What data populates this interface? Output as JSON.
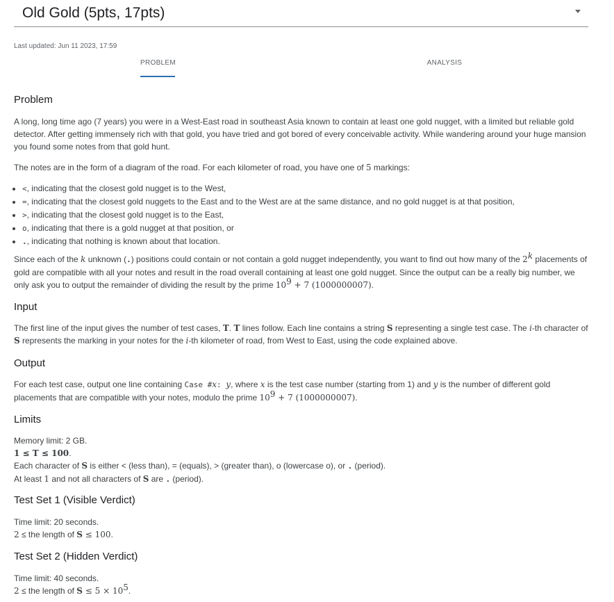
{
  "header": {
    "problem_title": "Old Gold (5pts, 17pts)",
    "last_updated": "Last updated: Jun 11 2023, 17:59"
  },
  "tabs": [
    {
      "label": "PROBLEM",
      "active": true
    },
    {
      "label": "ANALYSIS",
      "active": false
    }
  ],
  "sections": {
    "problem": {
      "heading": "Problem",
      "p1": "A long, long time ago (7 years) you were in a West-East road in southeast Asia known to contain at least one gold nugget, with a limited but reliable gold detector. After getting immensely rich with that gold, you have tried and got bored of every conceivable activity. While wandering around your huge mansion you found some notes from that gold hunt.",
      "p2_a": "The notes are in the form of a diagram of the road. For each kilometer of road, you have one of ",
      "p2_num": "5",
      "p2_b": " markings:",
      "bullets": [
        {
          "sym": "<",
          "text": ", indicating that the closest gold nugget is to the West,"
        },
        {
          "sym": "=",
          "text": ", indicating that the closest gold nuggets to the East and to the West are at the same distance, and no gold nugget is at that position,"
        },
        {
          "sym": ">",
          "text": ", indicating that the closest gold nugget is to the East,"
        },
        {
          "sym": "o",
          "text": ", indicating that there is a gold nugget at that position, or"
        },
        {
          "sym": ".",
          "text": ", indicating that nothing is known about that location."
        }
      ],
      "p3_a": "Since each of the ",
      "p3_k": "k",
      "p3_b": " unknown (",
      "p3_dot": ".",
      "p3_c": ") positions could contain or not contain a gold nugget independently, you want to find out how many of the ",
      "p3_pow_base": "2",
      "p3_pow_exp": "k",
      "p3_d": " placements of gold are compatible with all your notes and result in the road overall containing at least one gold nugget. Since the output can be a really big number, we only ask you to output the remainder of dividing the result by the prime ",
      "p3_prime_base": "10",
      "p3_prime_exp": "9",
      "p3_prime_rest": " + 7 (1000000007)",
      "p3_e": "."
    },
    "input": {
      "heading": "Input",
      "a": "The first line of the input gives the number of test cases, ",
      "T1": "T",
      "b": ". ",
      "T2": "T",
      "c": " lines follow. Each line contains a string ",
      "S1": "S",
      "d": " representing a single test case. The ",
      "i1": "i",
      "e": "-th character of ",
      "S2": "S",
      "f": " represents the marking in your notes for the ",
      "i2": "i",
      "g": "-th kilometer of road, from West to East, using the code explained above."
    },
    "output": {
      "heading": "Output",
      "a": "For each test case, output one line containing ",
      "code": "Case #",
      "x1": "x",
      "code2": ": ",
      "y1": "y",
      "b": ", where ",
      "x2": "x",
      "c": " is the test case number (starting from 1) and ",
      "y2": "y",
      "d": " is the number of different gold placements that are compatible with your notes, modulo the prime ",
      "prime_base": "10",
      "prime_exp": "9",
      "prime_rest": " + 7 (1000000007)",
      "e": "."
    },
    "limits": {
      "heading": "Limits",
      "memory": "Memory limit: 2 GB.",
      "t_range": "1 ≤ T ≤ 100",
      "t_range_end": ".",
      "chars_a": "Each character of ",
      "chars_S": "S",
      "chars_b": " is either < (less than), = (equals), > (greater than), o (lowercase o), or ",
      "chars_dot": ".",
      "chars_c": " (period).",
      "least_a": "At least ",
      "least_1": "1",
      "least_b": " and not all characters of ",
      "least_S": "S",
      "least_c": " are ",
      "least_dot": ".",
      "least_d": " (period)."
    },
    "test_set_1": {
      "heading": "Test Set 1 (Visible Verdict)",
      "time": "Time limit: 20 seconds.",
      "lo": "2",
      "mid": " ≤ the length of ",
      "S": "S",
      "hi": " ≤ 100",
      "end": "."
    },
    "test_set_2": {
      "heading": "Test Set 2 (Hidden Verdict)",
      "time": "Time limit: 40 seconds.",
      "lo": "2",
      "mid": " ≤ the length of ",
      "S": "S",
      "hi": " ≤ 5 × 10",
      "hi_exp": "5",
      "end": "."
    }
  }
}
